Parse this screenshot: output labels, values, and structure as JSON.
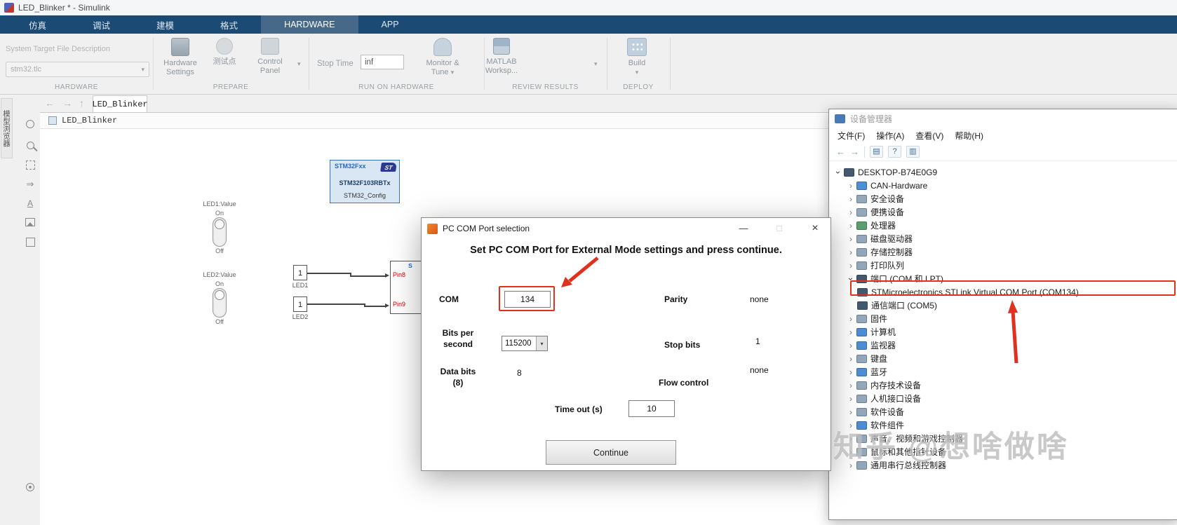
{
  "titlebar": {
    "title": "LED_Blinker * - Simulink"
  },
  "tabs": [
    "仿真",
    "调试",
    "建模",
    "格式",
    "HARDWARE",
    "APP"
  ],
  "ribbon": {
    "hardware": {
      "section": "HARDWARE",
      "desc": "System Target File Description",
      "tlc": "stm32.tlc"
    },
    "prepare": {
      "section": "PREPARE",
      "hw_settings": "Hardware Settings",
      "testpoint": "测试点",
      "control_panel": "Control Panel"
    },
    "run": {
      "section": "RUN ON HARDWARE",
      "stop_time_label": "Stop Time",
      "stop_time_value": "inf",
      "monitor_tune": "Monitor & Tune"
    },
    "review": {
      "section": "REVIEW RESULTS",
      "matlab_workspace": "MATLAB Worksp..."
    },
    "deploy": {
      "section": "DEPLOY",
      "build": "Build"
    }
  },
  "explorer": {
    "vertical_label": "模型浏览器"
  },
  "canvas": {
    "model_tab": "LED_Blinker",
    "breadcrumb": "LED_Blinker",
    "stm32": {
      "title": "STM32Fxx",
      "logo": "ST",
      "mcu": "STM32F103RBTx",
      "config": "STM32_Config"
    },
    "led1_label": "LED1:Value",
    "led2_label": "LED2:Value",
    "on": "On",
    "off": "Off",
    "const_value": "1",
    "const1_name": "LED1",
    "const2_name": "LED2",
    "pin_title": "S",
    "pin8": "Pin8",
    "pin9": "Pin9"
  },
  "dialog": {
    "title": "PC COM Port selection",
    "heading": "Set PC COM Port for External Mode settings and press continue.",
    "com_label": "COM",
    "com_value": "134",
    "parity_label": "Parity",
    "parity_value": "none",
    "bps_label": "Bits per second",
    "bps_value": "115200",
    "stop_bits_label": "Stop bits",
    "stop_bits_value": "1",
    "data_bits_label": "Data bits (8)",
    "data_bits_value": "8",
    "flow_label": "Flow control",
    "flow_value": "none",
    "timeout_label": "Time out (s)",
    "timeout_value": "10",
    "continue_label": "Continue"
  },
  "device_manager": {
    "title": "设备管理器",
    "menu": [
      "文件(F)",
      "操作(A)",
      "查看(V)",
      "帮助(H)"
    ],
    "tree": [
      {
        "label": "DESKTOP-B74E0G9",
        "icon": "computer-icon",
        "level": 0,
        "expanded": true
      },
      {
        "label": "CAN-Hardware",
        "icon": "can-hardware-icon",
        "level": 1
      },
      {
        "label": "安全设备",
        "icon": "security-devices-icon",
        "level": 1
      },
      {
        "label": "便携设备",
        "icon": "portable-devices-icon",
        "level": 1
      },
      {
        "label": "处理器",
        "icon": "processors-icon",
        "level": 1
      },
      {
        "label": "磁盘驱动器",
        "icon": "disk-drives-icon",
        "level": 1
      },
      {
        "label": "存储控制器",
        "icon": "storage-controllers-icon",
        "level": 1
      },
      {
        "label": "打印队列",
        "icon": "print-queues-icon",
        "level": 1
      },
      {
        "label": "端口 (COM 和 LPT)",
        "icon": "ports-icon",
        "level": 1,
        "expanded": true
      },
      {
        "label": "STMicroelectronics STLink Virtual COM Port (COM134)",
        "icon": "com-port-icon",
        "level": 2,
        "highlighted": true
      },
      {
        "label": "通信端口 (COM5)",
        "icon": "com-port-icon",
        "level": 2
      },
      {
        "label": "固件",
        "icon": "firmware-icon",
        "level": 1
      },
      {
        "label": "计算机",
        "icon": "computer-category-icon",
        "level": 1
      },
      {
        "label": "监视器",
        "icon": "monitors-icon",
        "level": 1
      },
      {
        "label": "键盘",
        "icon": "keyboards-icon",
        "level": 1
      },
      {
        "label": "蓝牙",
        "icon": "bluetooth-icon",
        "level": 1
      },
      {
        "label": "内存技术设备",
        "icon": "memory-devices-icon",
        "level": 1
      },
      {
        "label": "人机接口设备",
        "icon": "hid-icon",
        "level": 1
      },
      {
        "label": "软件设备",
        "icon": "software-devices-icon",
        "level": 1
      },
      {
        "label": "软件组件",
        "icon": "software-components-icon",
        "level": 1
      },
      {
        "label": "声音、视频和游戏控制器",
        "icon": "sound-video-game-icon",
        "level": 1
      },
      {
        "label": "鼠标和其他指针设备",
        "icon": "mice-icon",
        "level": 1
      },
      {
        "label": "通用串行总线控制器",
        "icon": "usb-controllers-icon",
        "level": 1
      }
    ]
  },
  "watermark": {
    "text": "知乎 @想啥做啥"
  },
  "colors": {
    "annotation_red": "#e0301e",
    "ribbon_blue": "#1b4a74",
    "stm32_blue": "#3a76b5"
  }
}
